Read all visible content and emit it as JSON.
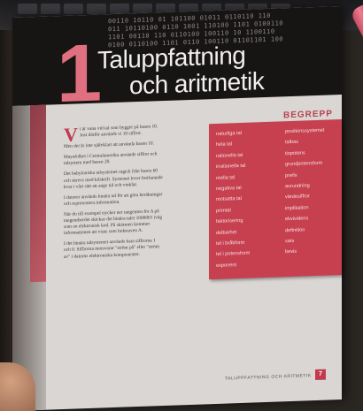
{
  "chapter": {
    "number": "1",
    "title_line1": "Taluppfattning",
    "title_line2": "och aritmetik"
  },
  "binary_pattern": [
    "00110 10110 01 101100 01011 0110110 110",
    "011 10110100 0110 1001 110100 1101 0100110",
    "1101 00110 110 0110100 100110 10 1100110",
    "0100 0110100 1101 0110 100110 01101101 100"
  ],
  "body": {
    "dropcap": "V",
    "paragraphs": [
      "i är vana vid tal som bygger på basen 10. Just därför används vi 10 siffror.",
      "Men det är inte självklart att använda basen 10.",
      "Mayafolket i Centralamerika använde siffror och talsystem med basen 20.",
      "Det babyloniska talsystemet utgick från basen 60 och skrevs med kilskrift. Systemet lever fortfarande kvar i vårt sätt att ange tid och vinklar.",
      "I datorer används binära tal för att göra beräkningar och representera information.",
      "När du till exempel trycker ner tangenten för A på tangentbordet skickas det binära talet 1000001 iväg som en elektronisk kod. På skärmen kommer informationen att visas som bokstaven A.",
      "I det binära talsystemet används bara siffrorna 1 och 0. Siffrorna motsvarar \"ström på\" eller \"ström av\" i datorns elektroniska komponenter."
    ]
  },
  "begrepp": {
    "heading": "BEGREPP",
    "column1": [
      "naturliga tal",
      "hela tal",
      "rationella tal",
      "irrationella tal",
      "reella tal",
      "negativa tal",
      "motsatta tal",
      "primtal",
      "faktorisering",
      "delbarhet",
      "tal i bråkform",
      "tal i potensform",
      "exponent"
    ],
    "column2": [
      "positionssystemet",
      "talbas",
      "tiopotens",
      "grundpotensform",
      "prefix",
      "avrundning",
      "värdesiffror",
      "implikation",
      "ekvivalens",
      "definition",
      "sats",
      "bevis"
    ]
  },
  "footer": {
    "running_title": "TALUPPFATTNING OCH ARITMETIK",
    "page_number": "7"
  },
  "colors": {
    "accent_red": "#c7404f",
    "banner_dark": "#171414",
    "page": "#d9d6d3"
  }
}
